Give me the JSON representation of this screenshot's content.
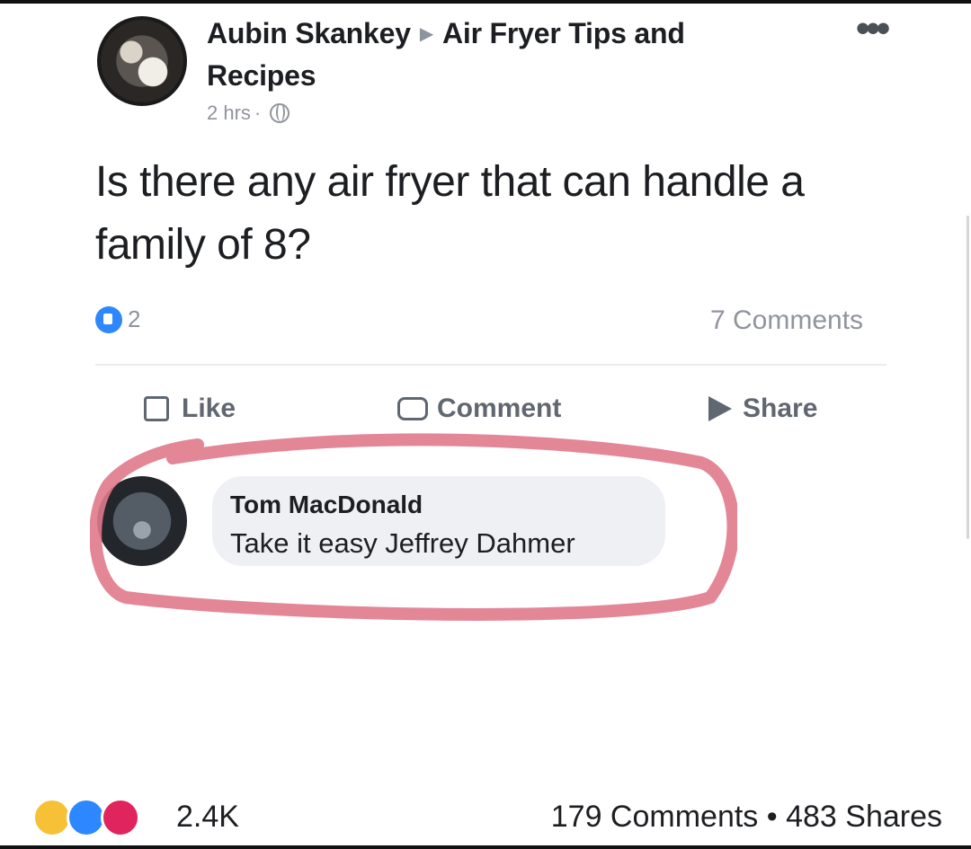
{
  "post": {
    "author": "Aubin Skankey",
    "group": "Air Fryer Tips and Recipes",
    "time": "2 hrs",
    "time_separator": "·",
    "text": "Is there any air fryer that can handle a family of 8?",
    "reaction_count": "2",
    "comments_label": "7 Comments"
  },
  "actions": {
    "like": "Like",
    "comment": "Comment",
    "share": "Share"
  },
  "comment": {
    "author": "Tom MacDonald",
    "text": "Take it easy Jeffrey Dahmer"
  },
  "footer": {
    "reactions": "2.4K",
    "stats": "179 Comments • 483 Shares"
  },
  "icons": {
    "header_arrow": "▶",
    "more": "•••",
    "globe": "globe-icon"
  },
  "colors": {
    "highlight": "#e07a8c",
    "like_blue": "#2d88ff",
    "love_red": "#e0245e",
    "haha_yellow": "#f7c137"
  }
}
